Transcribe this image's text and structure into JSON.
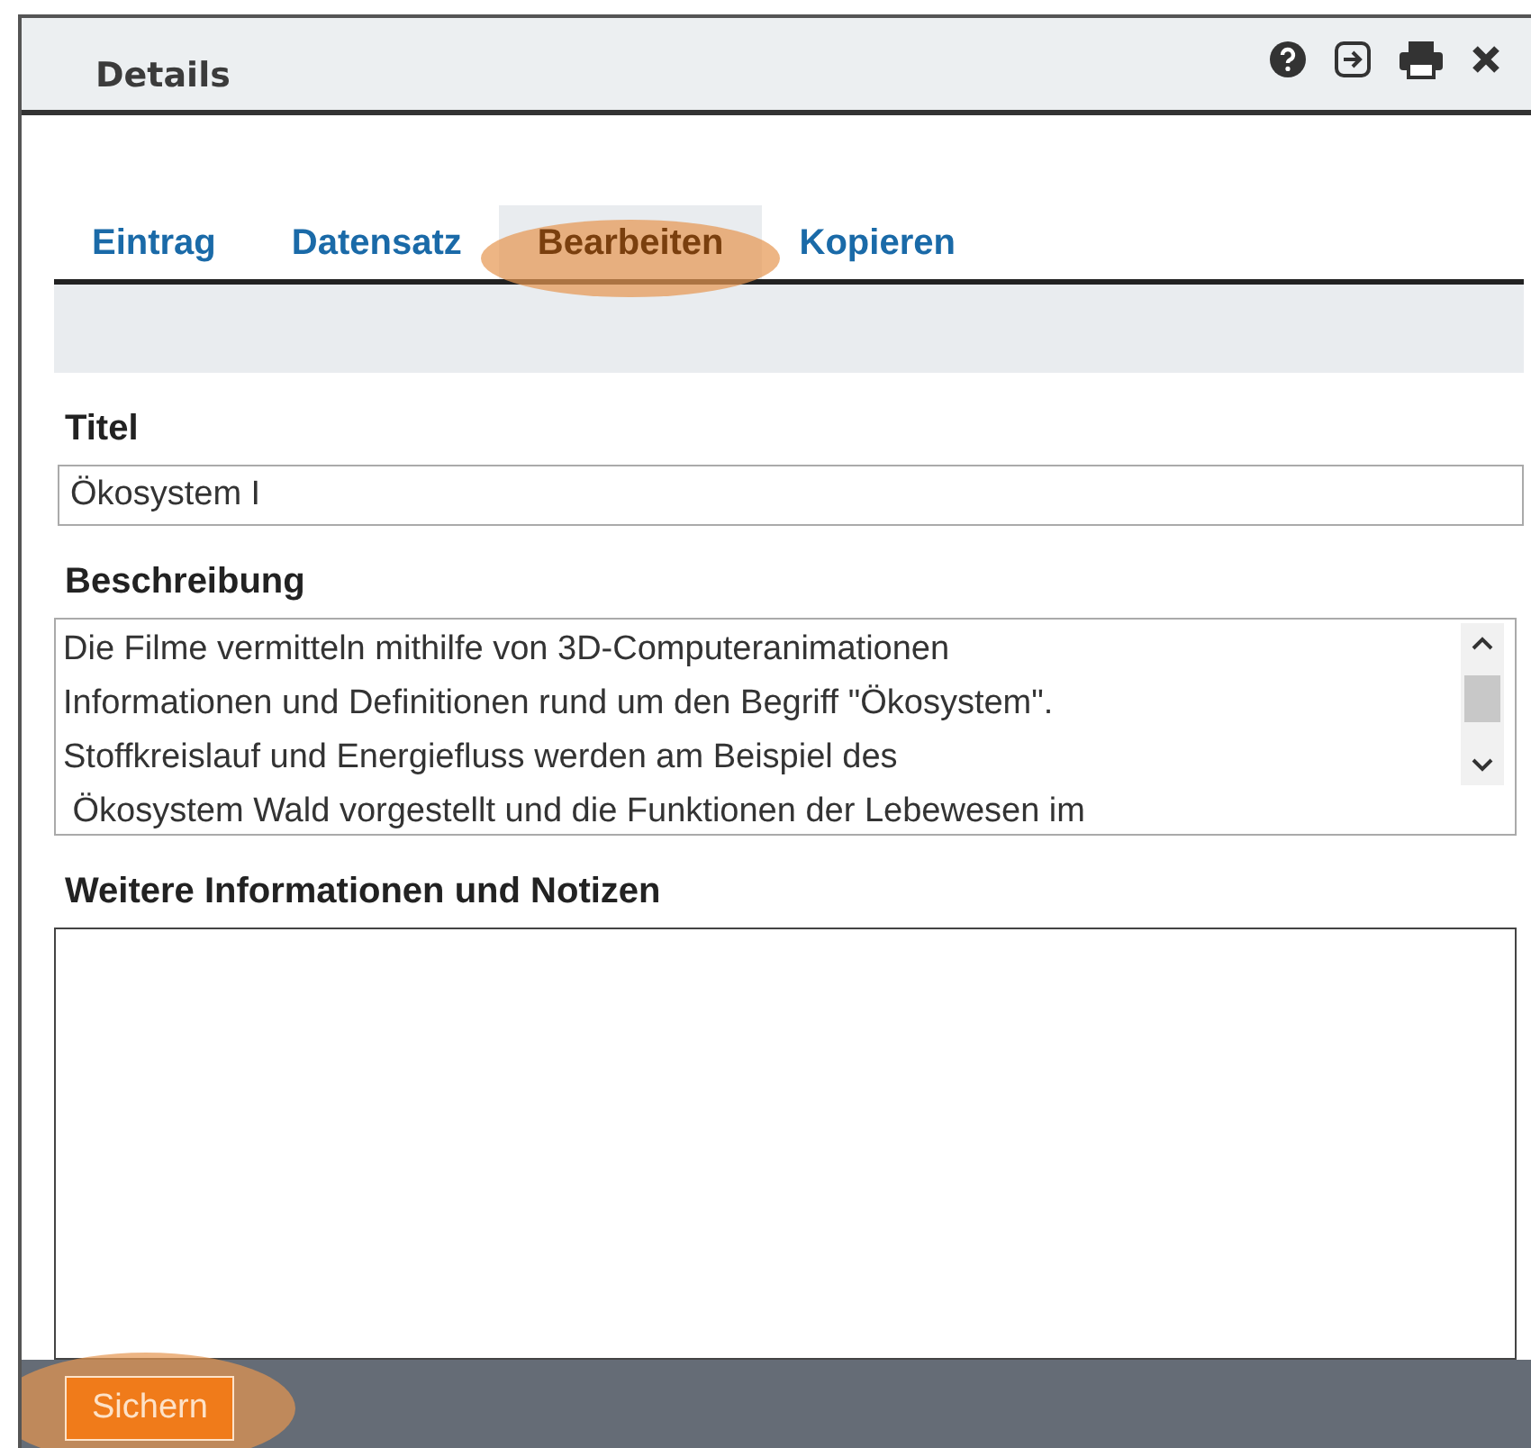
{
  "window": {
    "title": "Details"
  },
  "tabs": [
    {
      "label": "Eintrag",
      "selected": false,
      "highlighted": false
    },
    {
      "label": "Datensatz",
      "selected": false,
      "highlighted": false
    },
    {
      "label": "Bearbeiten",
      "selected": true,
      "highlighted": true
    },
    {
      "label": "Kopieren",
      "selected": false,
      "highlighted": false
    }
  ],
  "fields": [
    {
      "kind": "input",
      "label": "Titel",
      "value": "Ökosystem I"
    },
    {
      "kind": "textarea",
      "label": "Beschreibung",
      "value": "Die Filme vermitteln mithilfe von 3D-Computeranimationen\nInformationen und Definitionen rund um den Begriff \"Ökosystem\".\nStoffkreislauf und Energiefluss werden am Beispiel des\n Ökosystem Wald vorgestellt und die Funktionen der Lebewesen im"
    },
    {
      "kind": "notes",
      "label": "Weitere Informationen und Notizen"
    }
  ],
  "save_button": {
    "label": "Sichern",
    "highlighted": true
  }
}
